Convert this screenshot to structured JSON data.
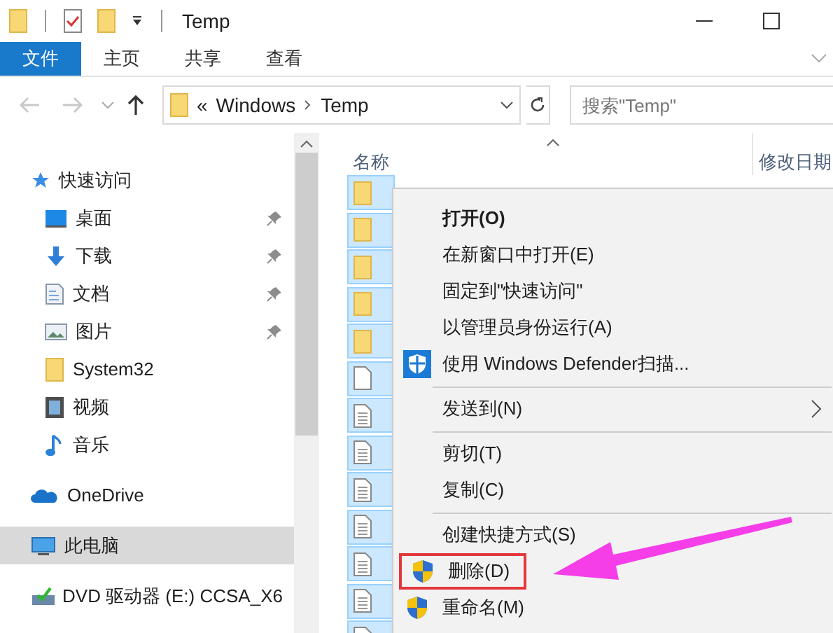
{
  "window": {
    "title": "Temp"
  },
  "quick_access_toolbar": [
    {
      "kind": "folder"
    },
    {
      "kind": "properties"
    },
    {
      "kind": "folder"
    },
    {
      "kind": "customize"
    }
  ],
  "ribbon_tabs": [
    {
      "label": "文件",
      "selected": true
    },
    {
      "label": "主页",
      "selected": false
    },
    {
      "label": "共享",
      "selected": false
    },
    {
      "label": "查看",
      "selected": false
    }
  ],
  "navigation": [
    {
      "kind": "back",
      "disabled": true
    },
    {
      "kind": "forward",
      "disabled": true
    },
    {
      "kind": "recent",
      "disabled": false
    },
    {
      "kind": "up",
      "disabled": false
    }
  ],
  "address": {
    "overflow": "«",
    "segments": [
      "Windows",
      "Temp"
    ]
  },
  "search": {
    "placeholder": "搜索\"Temp\""
  },
  "sidebar": [
    {
      "label": "快速访问",
      "kind": "star",
      "selected": false,
      "children": [
        {
          "label": "桌面",
          "kind": "desktop",
          "pinned": true,
          "selected": false
        },
        {
          "label": "下载",
          "kind": "download",
          "pinned": true,
          "selected": false
        },
        {
          "label": "文档",
          "kind": "documents",
          "pinned": true,
          "selected": false
        },
        {
          "label": "图片",
          "kind": "pictures",
          "pinned": true,
          "selected": false
        },
        {
          "label": "System32",
          "kind": "folder",
          "pinned": false,
          "selected": false
        },
        {
          "label": "视频",
          "kind": "videos",
          "pinned": false,
          "selected": false
        },
        {
          "label": "音乐",
          "kind": "music",
          "pinned": false,
          "selected": false
        }
      ]
    },
    {
      "label": "OneDrive",
      "kind": "cloud",
      "selected": false
    },
    {
      "label": "此电脑",
      "kind": "computer",
      "selected": true
    },
    {
      "label": "DVD 驱动器 (E:) CCSA_X6",
      "kind": "dvd",
      "selected": false
    }
  ],
  "columns": [
    "名称",
    "修改日期"
  ],
  "files": [
    {
      "kind": "folder",
      "selected": true
    },
    {
      "kind": "folder",
      "selected": true
    },
    {
      "kind": "folder",
      "selected": true
    },
    {
      "kind": "folder",
      "selected": true
    },
    {
      "kind": "folder",
      "selected": true
    },
    {
      "kind": "blank",
      "selected": true
    },
    {
      "kind": "text",
      "selected": true
    },
    {
      "kind": "text",
      "selected": true
    },
    {
      "kind": "text",
      "selected": true
    },
    {
      "kind": "text",
      "selected": true
    },
    {
      "kind": "text",
      "selected": true
    },
    {
      "kind": "text",
      "selected": true
    },
    {
      "kind": "text",
      "selected": true
    }
  ],
  "context_menu": [
    {
      "kind": "item",
      "label": "打开(O)",
      "default": true
    },
    {
      "kind": "item",
      "label": "在新窗口中打开(E)",
      "default": false
    },
    {
      "kind": "item",
      "label": "固定到\"快速访问\"",
      "default": false
    },
    {
      "kind": "item",
      "label": "以管理员身份运行(A)",
      "default": false
    },
    {
      "kind": "defender",
      "label": "使用 Windows Defender扫描...",
      "default": false
    },
    {
      "kind": "separator"
    },
    {
      "kind": "submenu",
      "label": "发送到(N)",
      "default": false
    },
    {
      "kind": "separator"
    },
    {
      "kind": "item",
      "label": "剪切(T)",
      "default": false
    },
    {
      "kind": "item",
      "label": "复制(C)",
      "default": false
    },
    {
      "kind": "separator"
    },
    {
      "kind": "item",
      "label": "创建快捷方式(S)",
      "default": false
    },
    {
      "kind": "uac",
      "label": "删除(D)",
      "default": false,
      "highlighted": true
    },
    {
      "kind": "uac",
      "label": "重命名(M)",
      "default": false
    }
  ],
  "annotation": {
    "arrow": true
  }
}
